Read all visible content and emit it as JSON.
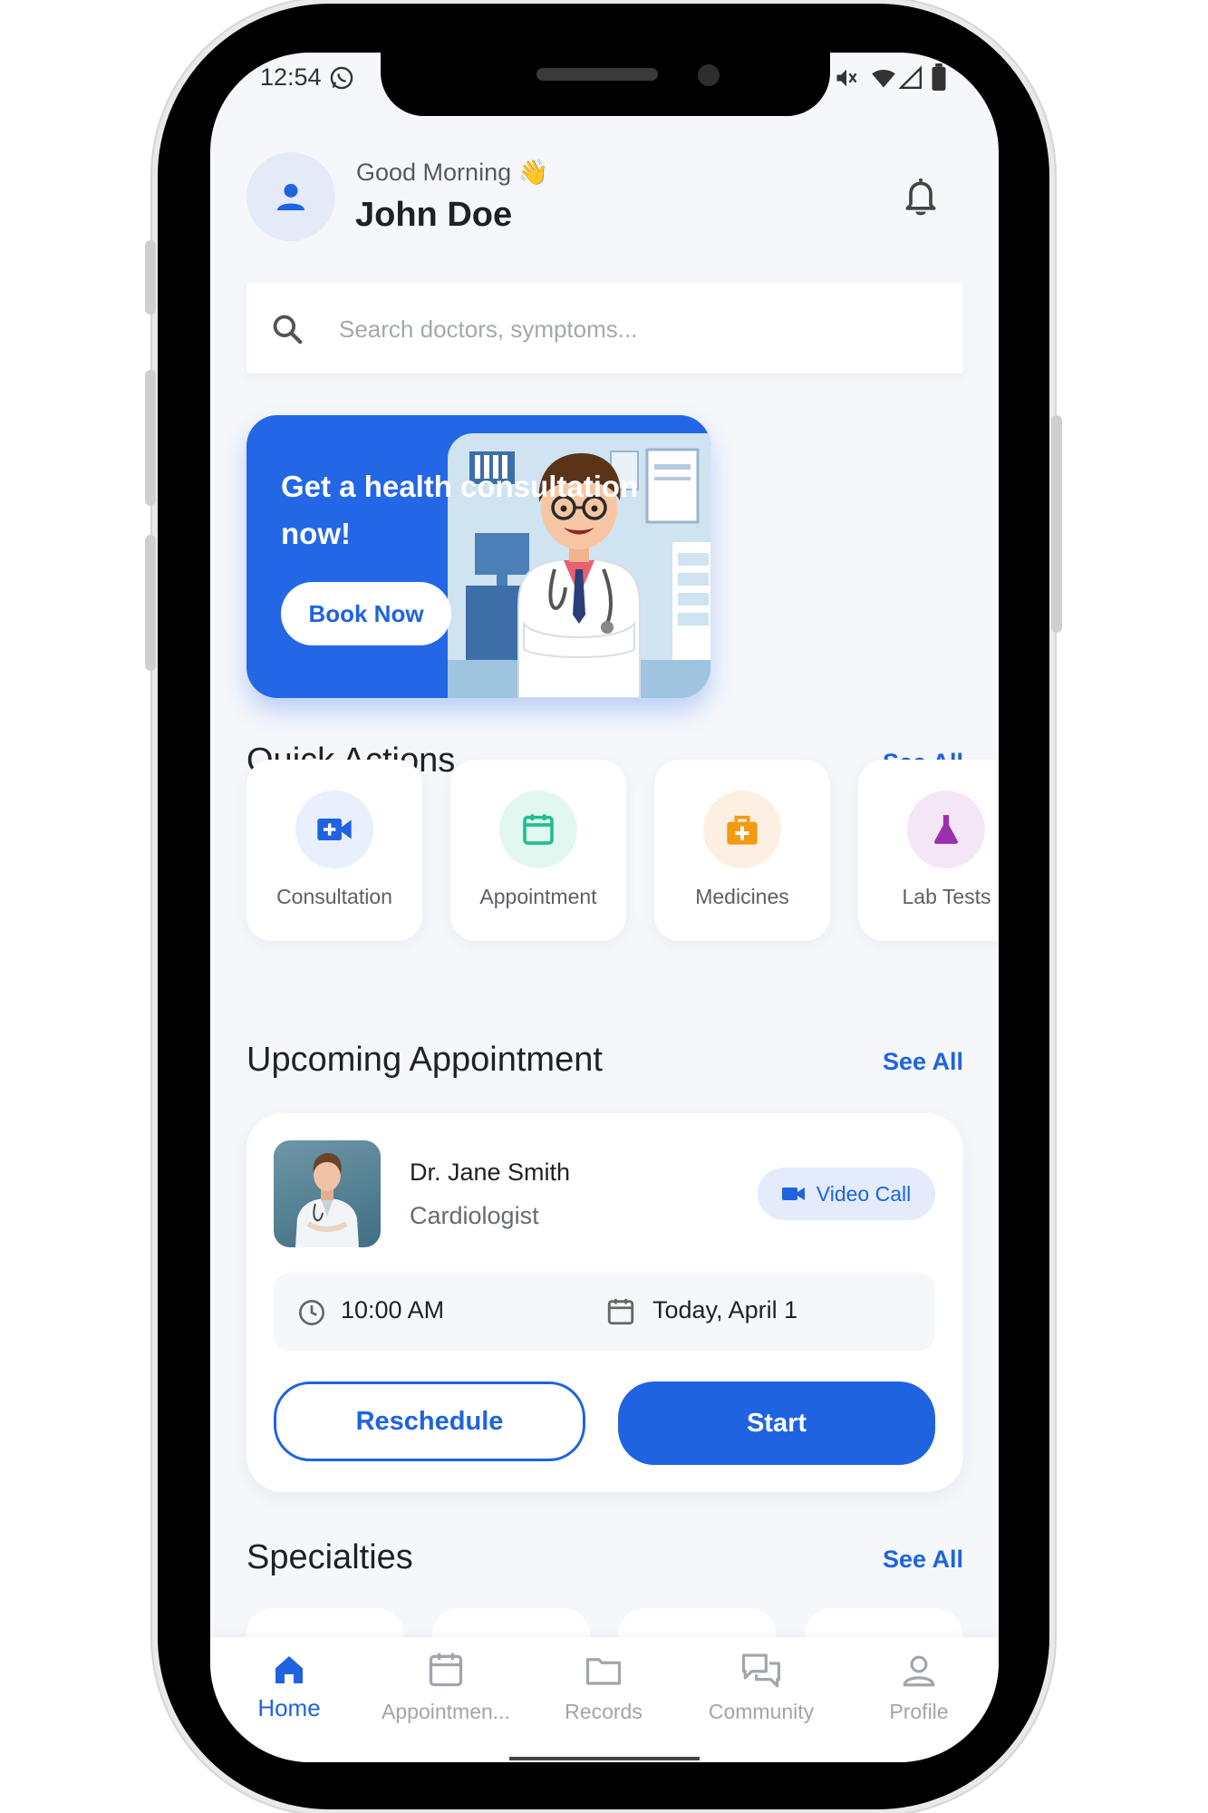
{
  "status_bar": {
    "time": "12:54"
  },
  "header": {
    "greeting": "Good Morning",
    "greeting_emoji": "👋",
    "user_name": "John Doe"
  },
  "search": {
    "placeholder": "Search doctors, symptoms..."
  },
  "banner": {
    "title_line1": "Get a health consultation",
    "title_line2": "now!",
    "button_label": "Book Now"
  },
  "quick_actions": {
    "title": "Quick Actions",
    "see_all": "See All",
    "items": [
      {
        "label": "Consultation",
        "icon": "video-plus-icon",
        "color": "#1f63e0",
        "bg": "#e8effd"
      },
      {
        "label": "Appointment",
        "icon": "calendar-icon",
        "color": "#1fbf8f",
        "bg": "#e3f7f1"
      },
      {
        "label": "Medicines",
        "icon": "medkit-icon",
        "color": "#f39a12",
        "bg": "#fdf0e2"
      },
      {
        "label": "Lab Tests",
        "icon": "flask-icon",
        "color": "#9b2fae",
        "bg": "#f4e6f7"
      }
    ]
  },
  "upcoming": {
    "title": "Upcoming Appointment",
    "see_all": "See All",
    "doctor_name": "Dr. Jane Smith",
    "specialty": "Cardiologist",
    "call_type": "Video Call",
    "time": "10:00 AM",
    "date": "Today, April 1",
    "reschedule_label": "Reschedule",
    "start_label": "Start"
  },
  "specialties": {
    "title": "Specialties",
    "see_all": "See All"
  },
  "bottom_nav": [
    {
      "label": "Home",
      "icon": "home-icon",
      "active": true
    },
    {
      "label": "Appointmen...",
      "icon": "calendar-icon",
      "active": false
    },
    {
      "label": "Records",
      "icon": "folder-icon",
      "active": false
    },
    {
      "label": "Community",
      "icon": "chat-icon",
      "active": false
    },
    {
      "label": "Profile",
      "icon": "person-icon",
      "active": false
    }
  ],
  "colors": {
    "primary": "#1f63e0",
    "background": "#f5f7fb",
    "text": "#1e2126",
    "muted": "#a1a5ac"
  }
}
